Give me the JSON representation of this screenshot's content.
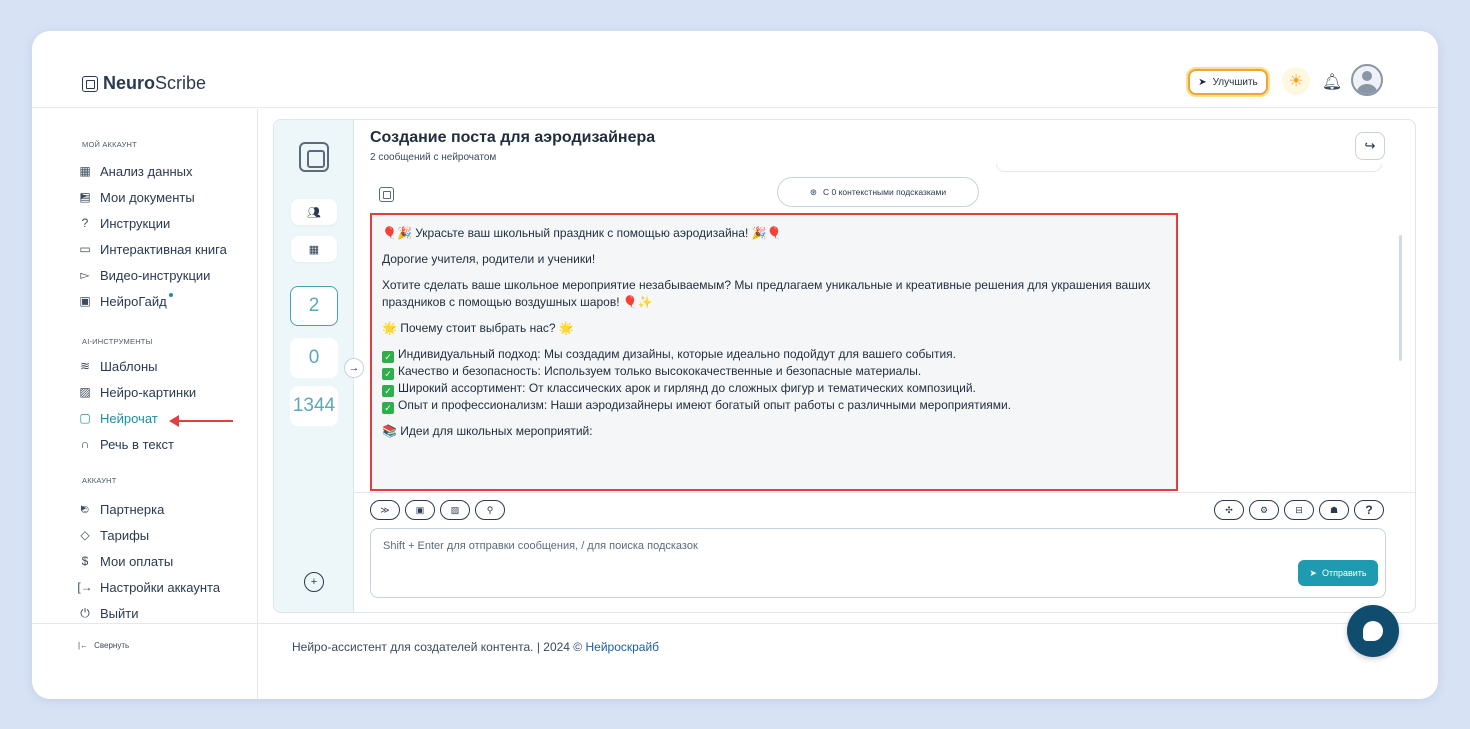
{
  "header": {
    "logo_bold": "Neuro",
    "logo_rest": "Scribe",
    "upgrade_label": "Улучшить"
  },
  "sidebar": {
    "section_account": "МОЙ АККАУНТ",
    "items_account": [
      {
        "label": "Анализ данных",
        "icon": "grid-icon"
      },
      {
        "label": "Мои документы",
        "icon": "document-icon"
      },
      {
        "label": "Инструкции",
        "icon": "help-icon"
      },
      {
        "label": "Интерактивная книга",
        "icon": "book-icon"
      },
      {
        "label": "Видео-инструкции",
        "icon": "video-icon"
      },
      {
        "label": "НейроГайд",
        "icon": "guide-icon"
      }
    ],
    "section_tools": "AI-ИНСТРУМЕНТЫ",
    "items_tools": [
      {
        "label": "Шаблоны",
        "icon": "layers-icon"
      },
      {
        "label": "Нейро-картинки",
        "icon": "image-icon"
      },
      {
        "label": "Нейрочат",
        "icon": "chat-icon"
      },
      {
        "label": "Речь в текст",
        "icon": "headphones-icon"
      }
    ],
    "section_acc": "АККАУНТ",
    "items_acc": [
      {
        "label": "Партнерка",
        "icon": "users-icon"
      },
      {
        "label": "Тарифы",
        "icon": "tag-icon"
      },
      {
        "label": "Мои оплаты",
        "icon": "dollar-icon"
      },
      {
        "label": "Настройки аккаунта",
        "icon": "login-icon"
      },
      {
        "label": "Выйти",
        "icon": "power-icon"
      }
    ],
    "collapse_label": "Свернуть"
  },
  "strip": {
    "counters": [
      "2",
      "0",
      "1344"
    ]
  },
  "chat": {
    "title": "Создание поста для аэродизайнера",
    "subtitle": "2 сообщений с нейрочатом",
    "hints_label": "С 0 контекстными подсказками",
    "message": {
      "line1": "🎈🎉 Украсьте ваш школьный праздник с помощью аэродизайна! 🎉🎈",
      "line2": "Дорогие учителя, родители и ученики!",
      "line3": "Хотите сделать ваше школьное мероприятие незабываемым? Мы предлагаем уникальные и креативные решения для украшения ваших праздников с помощью воздушных шаров! 🎈✨",
      "line4": "🌟 Почему стоит выбрать нас? 🌟",
      "bullets": [
        "Индивидуальный подход: Мы создадим дизайны, которые идеально подойдут для вашего события.",
        "Качество и безопасность: Используем только высококачественные и безопасные материалы.",
        "Широкий ассортимент: От классических арок и гирлянд до сложных фигур и тематических композиций.",
        "Опыт и профессионализм: Наши аэродизайнеры имеют богатый опыт работы с различными мероприятиями."
      ],
      "line5": "📚 Идеи для школьных мероприятий:"
    },
    "input_placeholder": "Shift + Enter для отправки сообщения, / для поиска подсказок",
    "send_label": "Отправить"
  },
  "footer": {
    "text": "Нейро-ассистент для создателей контента.  | 2024 © ",
    "brand": "Нейроскрайб"
  },
  "colors": {
    "accent": "#1e9bb0",
    "highlight_border": "#e53e3e",
    "background": "#d7e2f5"
  }
}
